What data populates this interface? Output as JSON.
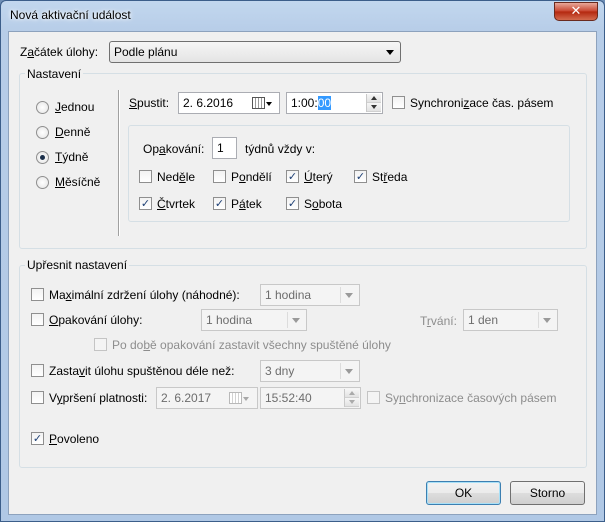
{
  "window": {
    "title": "Nová aktivační událost",
    "close_glyph": "✕"
  },
  "task_start": {
    "label_pre": "Z",
    "label_u": "a",
    "label_post": "čátek úlohy:",
    "value": "Podle plánu"
  },
  "settings": {
    "title": "Nastavení",
    "radios": [
      {
        "pre": "",
        "u": "J",
        "post": "ednou",
        "checked": false
      },
      {
        "pre": "",
        "u": "D",
        "post": "enně",
        "checked": false
      },
      {
        "pre": "",
        "u": "T",
        "post": "ýdně",
        "checked": true
      },
      {
        "pre": "",
        "u": "M",
        "post": "ěsíčně",
        "checked": false
      }
    ],
    "start": {
      "label_pre": "",
      "label_u": "S",
      "label_post": "pustit:",
      "date": "2.  6.2016",
      "time_pre": "1:00:",
      "time_sel": "00",
      "sync_label_pre": "Synchroni",
      "sync_label_u": "z",
      "sync_label_post": "ace čas. pásem",
      "sync_checked": false
    },
    "weekly": {
      "repeat_label_pre": "Op",
      "repeat_label_u": "a",
      "repeat_label_post": "kování:",
      "repeat_value": "1",
      "suffix": "týdnů vždy v:",
      "days": [
        {
          "pre": "Ned",
          "u": "ě",
          "post": "le",
          "checked": false
        },
        {
          "pre": "P",
          "u": "o",
          "post": "ndělí",
          "checked": false
        },
        {
          "pre": "",
          "u": "Ú",
          "post": "terý",
          "checked": true
        },
        {
          "pre": "St",
          "u": "ř",
          "post": "eda",
          "checked": true
        },
        {
          "pre": "",
          "u": "Č",
          "post": "tvrtek",
          "checked": true
        },
        {
          "pre": "P",
          "u": "á",
          "post": "tek",
          "checked": true
        },
        {
          "pre": "S",
          "u": "o",
          "post": "bota",
          "checked": true
        }
      ]
    }
  },
  "advanced": {
    "title": "Upřesnit nastavení",
    "max_delay": {
      "pre": "Ma",
      "u": "x",
      "post": "imální zdržení úlohy (náhodné):",
      "value": "1 hodina",
      "checked": false
    },
    "repeat_task": {
      "pre": "",
      "u": "O",
      "post": "pakování úlohy:",
      "value": "1 hodina",
      "checked": false,
      "duration_label_pre": "T",
      "duration_label_u": "r",
      "duration_label_post": "vání:",
      "duration_value": "1 den"
    },
    "stop_all": {
      "pre": "Po do",
      "u": "b",
      "post": "ě opakování zastavit všechny spuštěné úlohy",
      "checked": false
    },
    "stop_longer": {
      "pre": "Zasta",
      "u": "v",
      "post": "it úlohu spuštěnou déle než:",
      "value": "3 dny",
      "checked": false
    },
    "expire": {
      "pre": "V",
      "u": "y",
      "post": "pršení platnosti:",
      "date": "2.  6.2017",
      "time": "15:52:40",
      "checked": false,
      "sync_pre": "Sy",
      "sync_u": "n",
      "sync_post": "chronizace časových pásem",
      "sync_checked": false
    },
    "enabled": {
      "pre": "",
      "u": "P",
      "post": "ovoleno",
      "checked": true
    }
  },
  "buttons": {
    "ok": "OK",
    "cancel": "Storno"
  },
  "check_glyph": "✓"
}
